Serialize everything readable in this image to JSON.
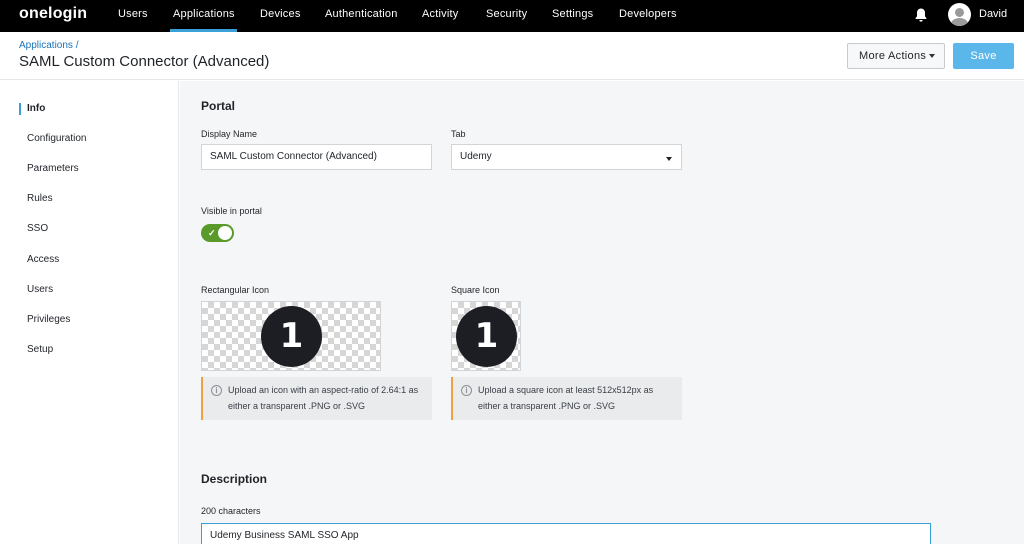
{
  "nav": {
    "logo": "onelogin",
    "items": [
      "Users",
      "Applications",
      "Devices",
      "Authentication",
      "Activity",
      "Security",
      "Settings",
      "Developers"
    ],
    "active": "Applications",
    "user": "David"
  },
  "header": {
    "breadcrumb": "Applications",
    "breadcrumb_sep": "/",
    "title": "SAML Custom Connector (Advanced)",
    "more_actions": "More Actions",
    "save": "Save"
  },
  "sidebar": {
    "items": [
      "Info",
      "Configuration",
      "Parameters",
      "Rules",
      "SSO",
      "Access",
      "Users",
      "Privileges",
      "Setup"
    ],
    "active": "Info"
  },
  "portal": {
    "title": "Portal",
    "display_name_label": "Display Name",
    "display_name_value": "SAML Custom Connector (Advanced)",
    "tab_label": "Tab",
    "tab_value": "Udemy",
    "visible_label": "Visible in portal",
    "visible_on": true,
    "rect_icon_label": "Rectangular Icon",
    "square_icon_label": "Square Icon",
    "rect_hint": "Upload an icon with an aspect-ratio of 2.64:1 as either a transparent .PNG or .SVG",
    "square_hint": "Upload a square icon at least 512x512px as either a transparent .PNG or .SVG",
    "icon_glyph": "1"
  },
  "description": {
    "title": "Description",
    "count_label": "200 characters",
    "value": "Udemy Business SAML SSO App"
  },
  "colors": {
    "accent": "#3ca0d8",
    "save_button": "#5bb7ea",
    "toggle_on": "#5a9a2a",
    "hint_border": "#f0a041"
  }
}
